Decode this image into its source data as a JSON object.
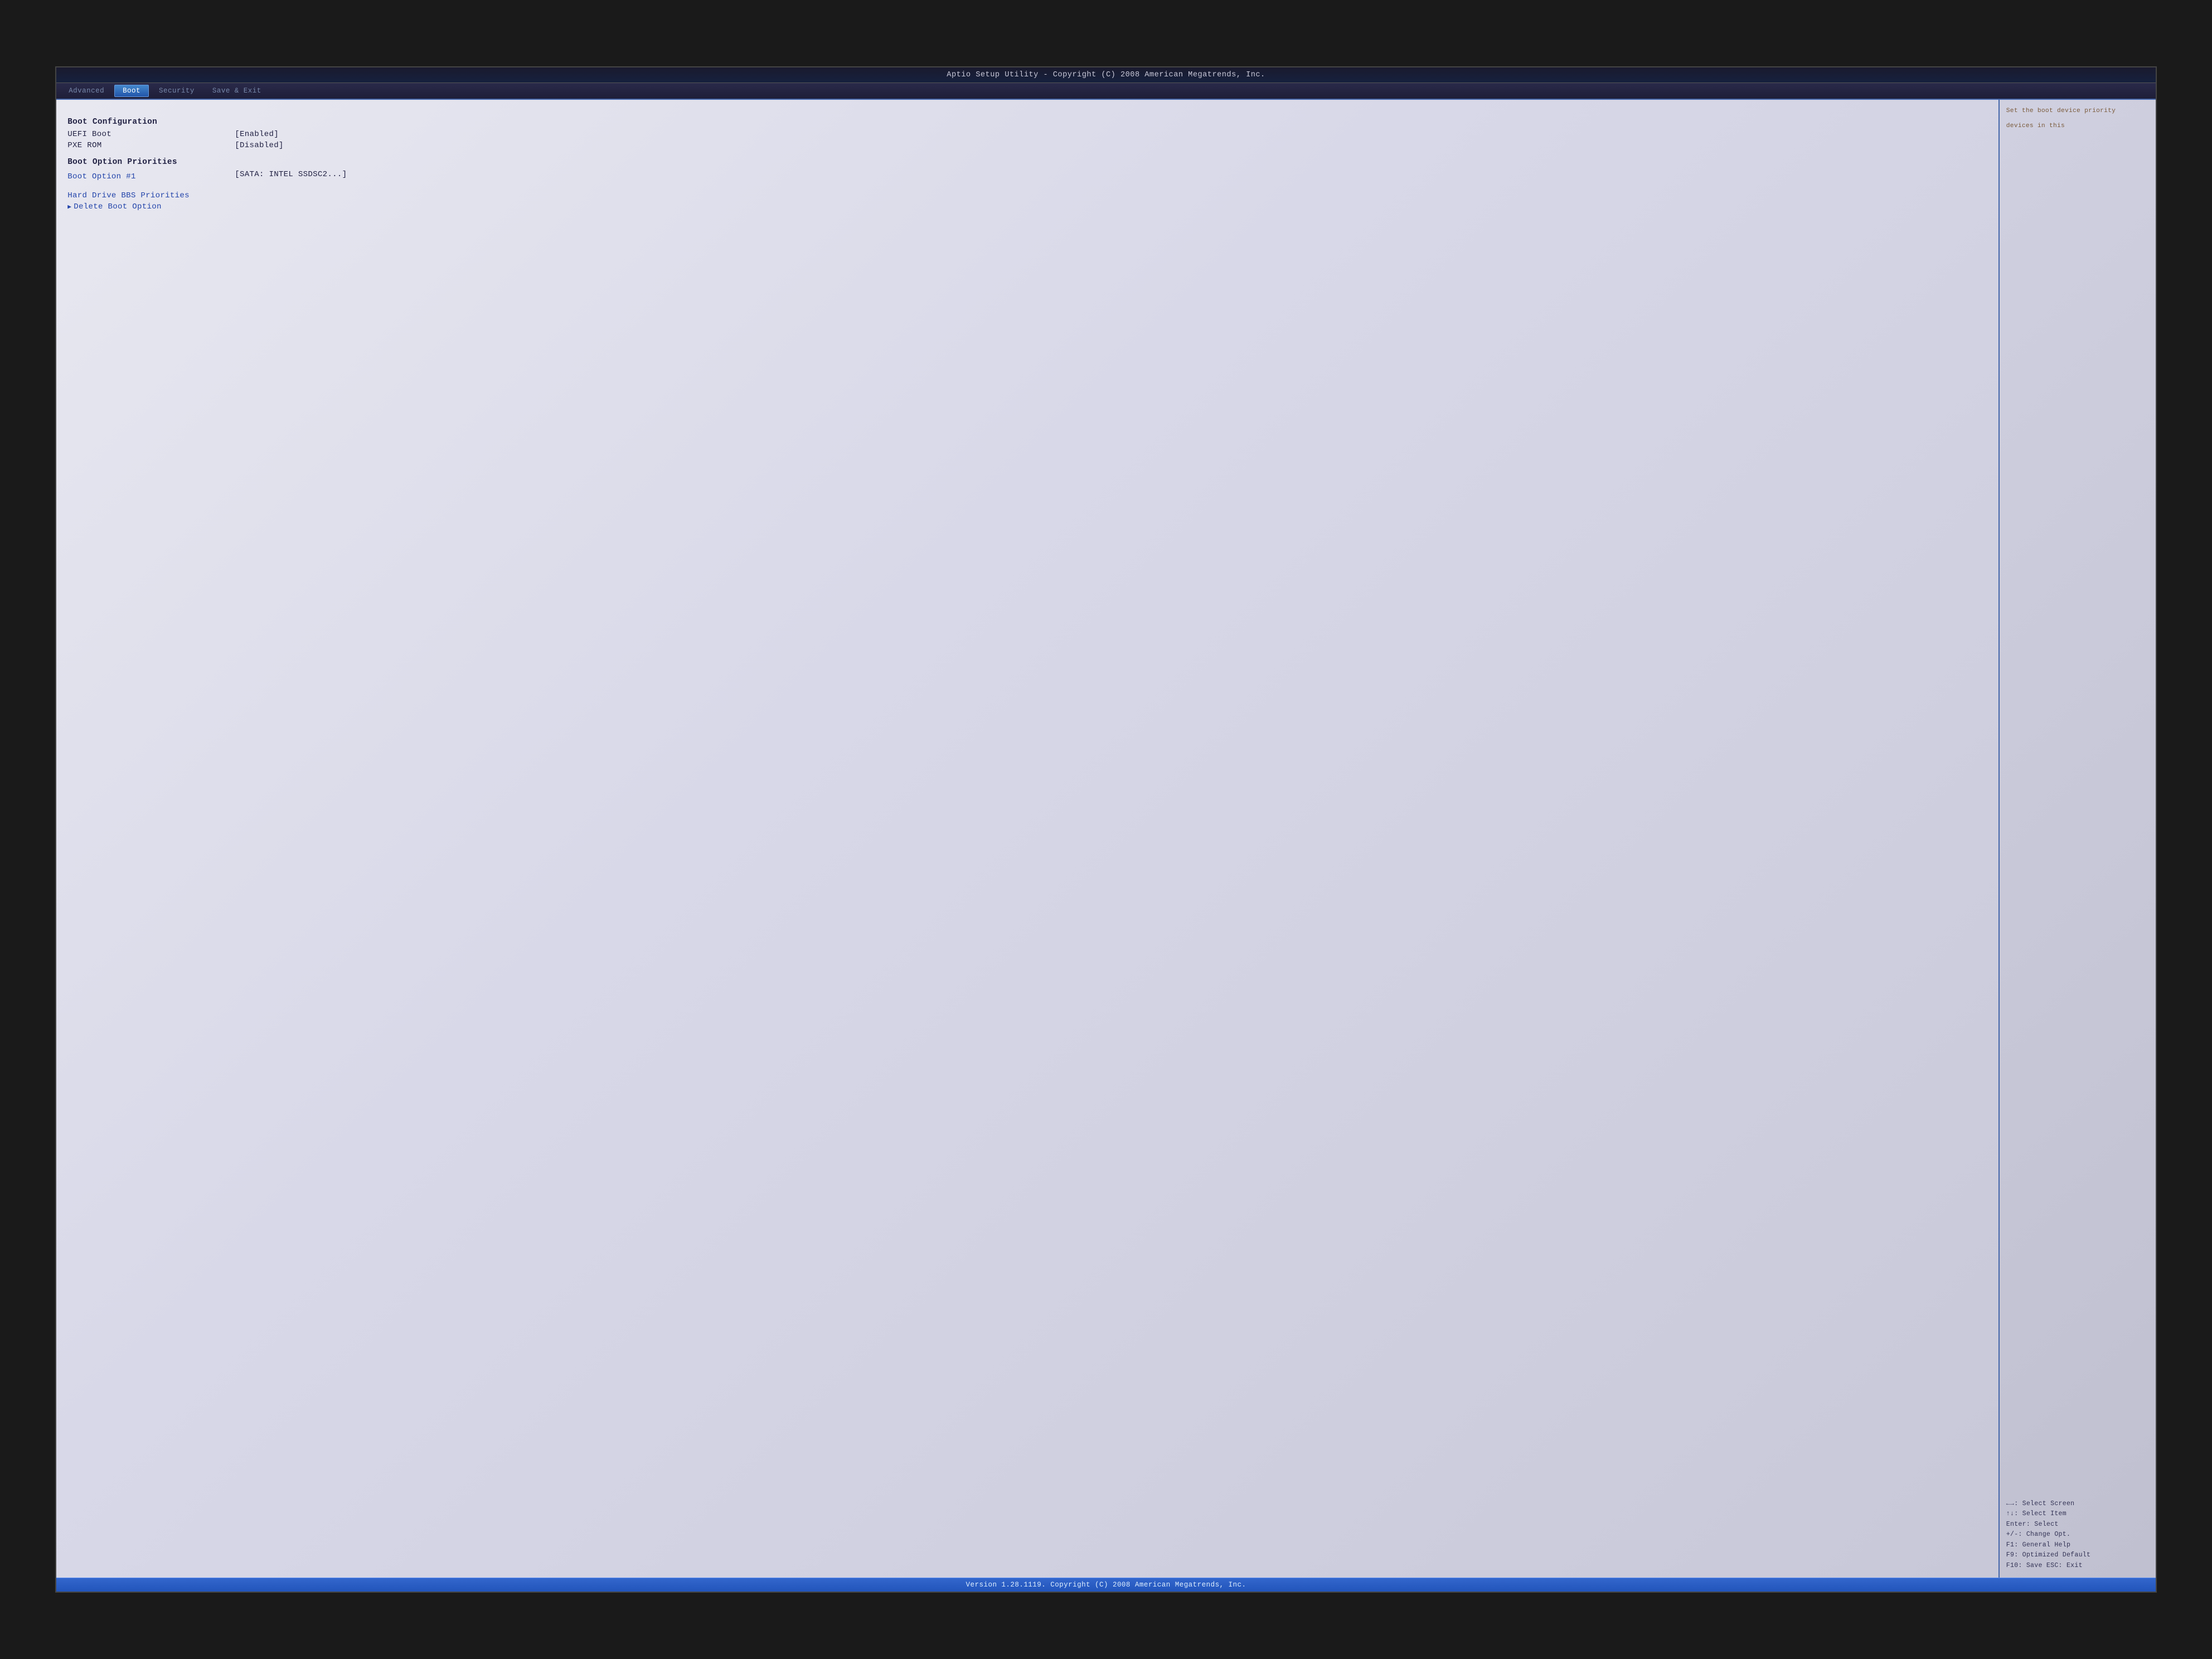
{
  "title_bar": {
    "text": "Aptio Setup Utility - Copyright (C) 2008 American Megatrends, Inc."
  },
  "nav": {
    "tabs": [
      {
        "label": "Advanced",
        "state": "inactive"
      },
      {
        "label": "Boot",
        "state": "active"
      },
      {
        "label": "Security",
        "state": "inactive"
      },
      {
        "label": "Save & Exit",
        "state": "inactive"
      }
    ]
  },
  "main": {
    "sections": [
      {
        "header": "Boot Configuration",
        "items": [
          {
            "type": "label-value",
            "label": "UEFI Boot",
            "value": "[Enabled]"
          },
          {
            "type": "label-value",
            "label": "PXE ROM",
            "value": "[Disabled]"
          }
        ]
      },
      {
        "header": "Boot Option Priorities",
        "items": [
          {
            "type": "label-value",
            "label": "Boot Option #1",
            "value": "[SATA: INTEL SSDSC2...]"
          }
        ]
      },
      {
        "header": "",
        "items": [
          {
            "type": "link",
            "label": "Hard Drive BBS Priorities",
            "arrow": false
          },
          {
            "type": "link",
            "label": "Delete Boot Option",
            "arrow": true
          }
        ]
      }
    ]
  },
  "right_panel": {
    "help_text": "Set the boot device priority",
    "help_text2": "devices in this",
    "keybindings": [
      "←→: Select Screen",
      "↑↓: Select Item",
      "Enter: Select",
      "+/-: Change Opt.",
      "F1: General Help",
      "F9: Optimized Default",
      "F10: Save  ESC: Exit"
    ]
  },
  "status_bar": {
    "text": "Version 1.28.1119. Copyright (C) 2008 American Megatrends, Inc."
  }
}
